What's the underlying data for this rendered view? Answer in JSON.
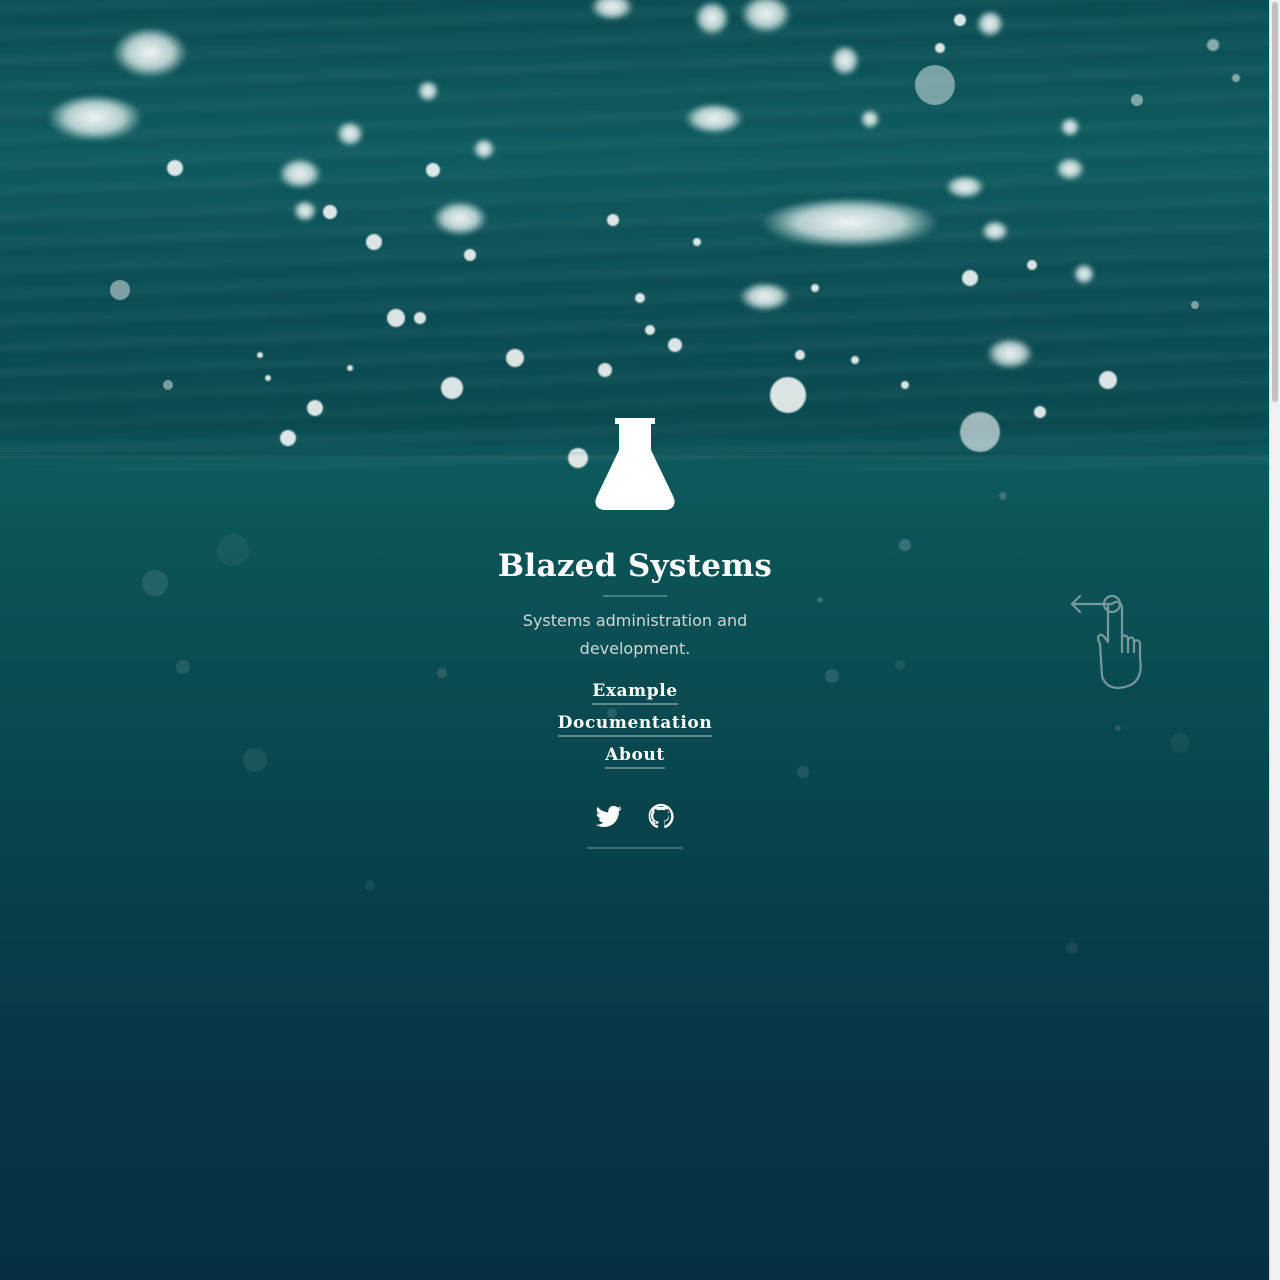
{
  "site": {
    "title": "Blazed Systems",
    "tagline": "Systems administration and development.",
    "logo_icon": "flask-icon"
  },
  "nav": {
    "items": [
      {
        "label": "Example"
      },
      {
        "label": "Documentation"
      },
      {
        "label": "About"
      }
    ]
  },
  "social": {
    "items": [
      {
        "icon": "twitter-icon"
      },
      {
        "icon": "github-icon"
      }
    ]
  },
  "hint": {
    "icon": "swipe-left-hand-icon"
  },
  "colors": {
    "water_top": "#0b4f54",
    "water_bottom": "#062f42",
    "text": "#ffffff"
  }
}
